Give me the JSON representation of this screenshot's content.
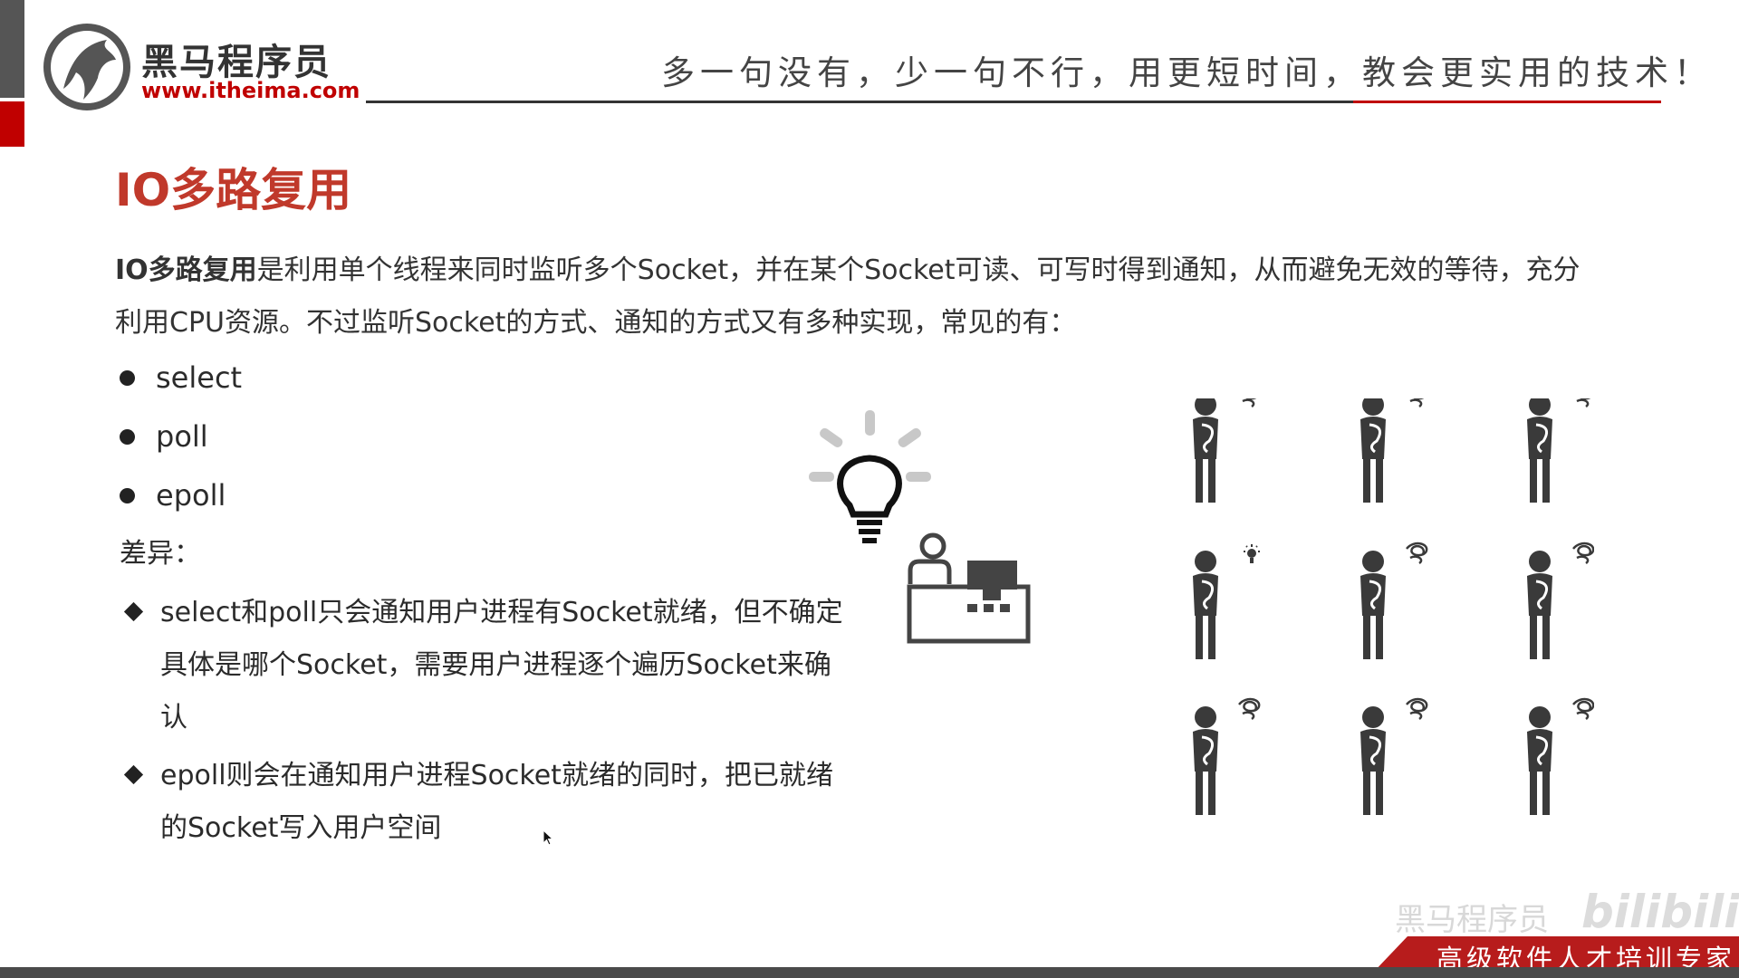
{
  "header": {
    "logo_name": "黑马程序员",
    "logo_url": "www.itheima.com",
    "slogan": "多一句没有，少一句不行，用更短时间，教会更实用的技术！"
  },
  "slide": {
    "title": "IO多路复用",
    "intro_bold": "IO多路复用",
    "intro_rest": "是利用单个线程来同时监听多个Socket，并在某个Socket可读、可写时得到通知，从而避免无效的等待，充分利用CPU资源。不过监听Socket的方式、通知的方式又有多种实现，常见的有：",
    "bullets": [
      "select",
      "poll",
      "epoll"
    ],
    "diff_label": "差异：",
    "differences": [
      "select和poll只会通知用户进程有Socket就绪，但不确定具体是哪个Socket，需要用户进程逐个遍历Socket来确认",
      "epoll则会在通知用户进程Socket就绪的同时，把已就绪的Socket写入用户空间"
    ]
  },
  "footer": {
    "watermark": "黑马程序员",
    "bilibili_logo": "bilibili",
    "tagline": "高级软件人才培训专家"
  }
}
